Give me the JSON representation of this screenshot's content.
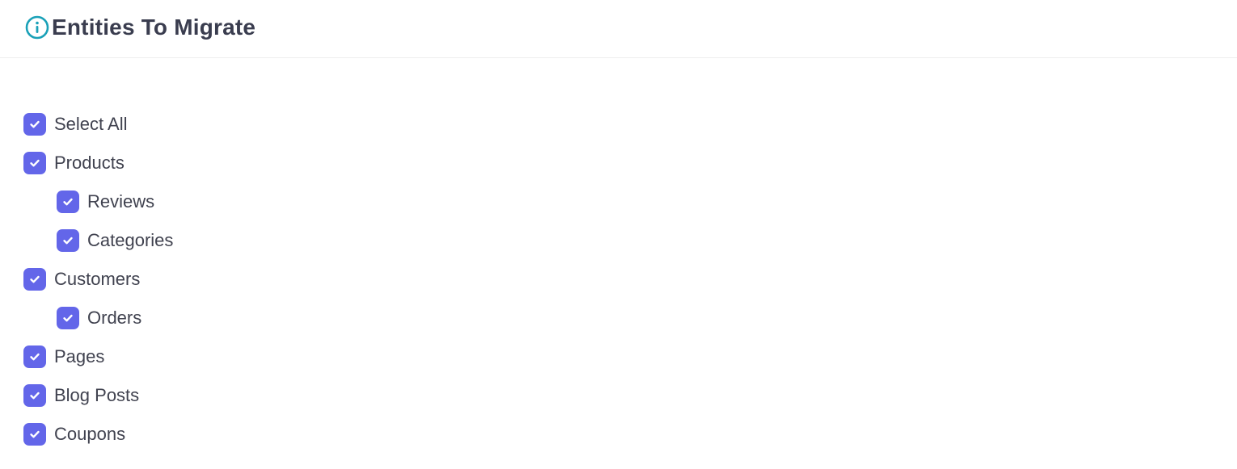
{
  "header": {
    "title": "Entities To Migrate",
    "icon": "info-circle-icon",
    "icon_color": "#1aa1b8"
  },
  "accent_color": "#6366e9",
  "entities": [
    {
      "label": "Select All",
      "checked": true,
      "level": 0
    },
    {
      "label": "Products",
      "checked": true,
      "level": 0
    },
    {
      "label": "Reviews",
      "checked": true,
      "level": 1
    },
    {
      "label": "Categories",
      "checked": true,
      "level": 1
    },
    {
      "label": "Customers",
      "checked": true,
      "level": 0
    },
    {
      "label": "Orders",
      "checked": true,
      "level": 1
    },
    {
      "label": "Pages",
      "checked": true,
      "level": 0
    },
    {
      "label": "Blog Posts",
      "checked": true,
      "level": 0
    },
    {
      "label": "Coupons",
      "checked": true,
      "level": 0
    }
  ]
}
